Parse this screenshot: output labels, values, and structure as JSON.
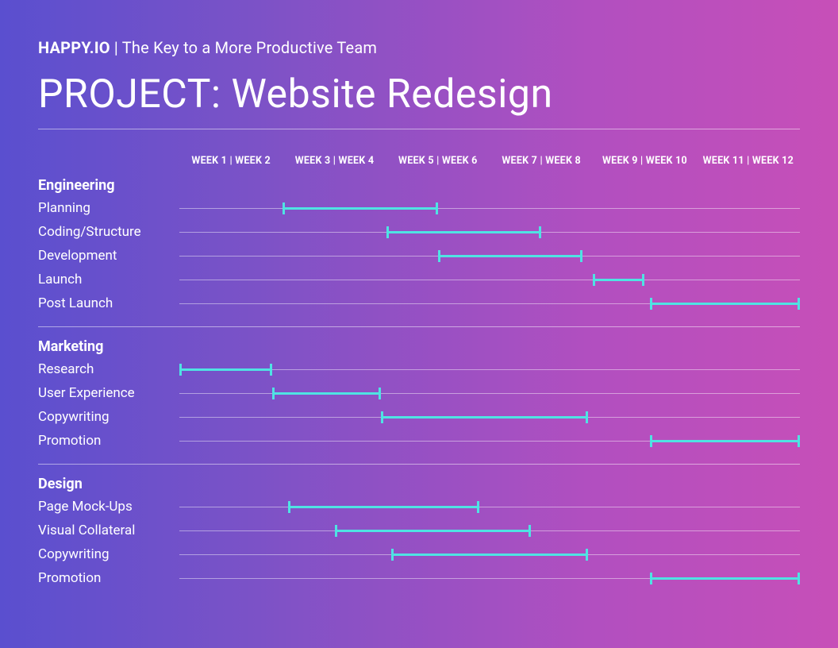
{
  "header": {
    "brand": "HAPPY.IO",
    "tagline": " | The Key to a More Productive Team"
  },
  "project_prefix": "PROJECT: ",
  "project_name": "Website Redesign",
  "weeks": [
    "WEEK 1 | WEEK 2",
    "WEEK 3 | WEEK 4",
    "WEEK 5 | WEEK 6",
    "WEEK 7 | WEEK 8",
    "WEEK 9 | WEEK 10",
    "WEEK 11 | WEEK 12"
  ],
  "sections": [
    {
      "name": "Engineering",
      "tasks": [
        {
          "label": "Planning"
        },
        {
          "label": "Coding/Structure"
        },
        {
          "label": "Development"
        },
        {
          "label": "Launch"
        },
        {
          "label": "Post Launch"
        }
      ]
    },
    {
      "name": "Marketing",
      "tasks": [
        {
          "label": "Research"
        },
        {
          "label": "User Experience"
        },
        {
          "label": "Copywriting"
        },
        {
          "label": "Promotion"
        }
      ]
    },
    {
      "name": "Design",
      "tasks": [
        {
          "label": "Page Mock-Ups"
        },
        {
          "label": "Visual Collateral"
        },
        {
          "label": "Copywriting"
        },
        {
          "label": "Promotion"
        }
      ]
    }
  ],
  "chart_data": {
    "type": "gantt",
    "title": "Website Redesign",
    "x_unit": "weeks",
    "x_range": [
      0,
      12
    ],
    "x_tick_labels": [
      "WEEK 1 | WEEK 2",
      "WEEK 3 | WEEK 4",
      "WEEK 5 | WEEK 6",
      "WEEK 7 | WEEK 8",
      "WEEK 9 | WEEK 10",
      "WEEK 11 | WEEK 12"
    ],
    "groups": [
      {
        "name": "Engineering",
        "tasks": [
          {
            "label": "Planning",
            "start": 2.0,
            "end": 5.0
          },
          {
            "label": "Coding/Structure",
            "start": 4.0,
            "end": 7.0
          },
          {
            "label": "Development",
            "start": 5.0,
            "end": 7.8
          },
          {
            "label": "Launch",
            "start": 8.0,
            "end": 9.0
          },
          {
            "label": "Post Launch",
            "start": 9.1,
            "end": 12.0
          }
        ]
      },
      {
        "name": "Marketing",
        "tasks": [
          {
            "label": "Research",
            "start": 0.0,
            "end": 1.8
          },
          {
            "label": "User Experience",
            "start": 1.8,
            "end": 3.9
          },
          {
            "label": "Copywriting",
            "start": 3.9,
            "end": 7.9
          },
          {
            "label": "Promotion",
            "start": 9.1,
            "end": 12.0
          }
        ]
      },
      {
        "name": "Design",
        "tasks": [
          {
            "label": "Page Mock-Ups",
            "start": 2.1,
            "end": 5.8
          },
          {
            "label": "Visual Collateral",
            "start": 3.0,
            "end": 6.8
          },
          {
            "label": "Copywriting",
            "start": 4.1,
            "end": 7.9
          },
          {
            "label": "Promotion",
            "start": 9.1,
            "end": 12.0
          }
        ]
      }
    ],
    "bar_color": "#4fe3e3"
  }
}
